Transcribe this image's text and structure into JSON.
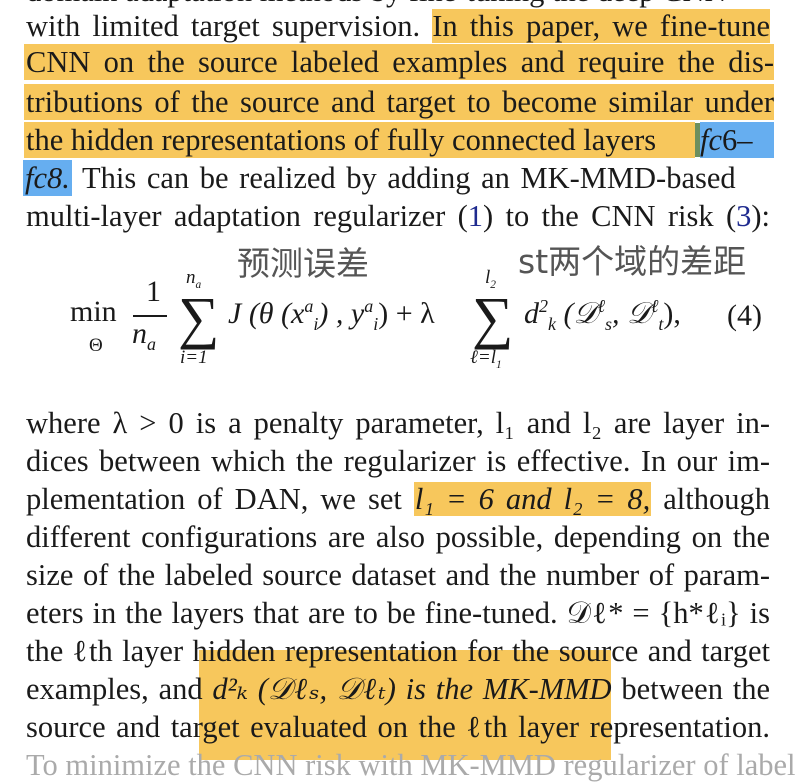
{
  "paragraph1": {
    "line1_plain": "with limited target supervision. ",
    "line1_hl": "In this paper, we fine-tune",
    "line2_hl": "CNN on the source labeled examples and require the dis-",
    "line3_hl": "tributions of the source and target to become similar under",
    "line4_hl": "the hidden representations of fully connected layers ",
    "line4_math_f": "f",
    "line4_math_c": "c",
    "line4_math_num": "6–",
    "line5_math": "fc8.",
    "line5_plain": " This can be realized by adding an MK-MMD-based",
    "line6_a": "multi-layer adaptation regularizer (",
    "line6_ref1": "1",
    "line6_b": ") to the CNN risk (",
    "line6_ref2": "3",
    "line6_c": "):"
  },
  "equation": {
    "min": "min",
    "min_sub": "Θ",
    "frac_num": "1",
    "frac_den": "n",
    "frac_den_sub": "a",
    "sum1_top": "n",
    "sum1_top_sub": "a",
    "sum1_bottom": "i=1",
    "sum_symbol": "∑",
    "term1": "J (θ (x",
    "term1_sup": "a",
    "term1_sub": "i",
    "term1_b": ") , y",
    "term1_b_sup": "a",
    "term1_b_sub": "i",
    "term1_close": ") + λ",
    "sum2_top": "l",
    "sum2_top_sub": "2",
    "sum2_bottom": "ℓ=l",
    "sum2_bottom_sub": "1",
    "term2": "d",
    "term2_sup": "2",
    "term2_sub": "k",
    "term2_args": "(𝒟",
    "term2_arg1_sup": "ℓ",
    "term2_arg1_sub": "s",
    "term2_comma": ", 𝒟",
    "term2_arg2_sup": "ℓ",
    "term2_arg2_sub": "t",
    "term2_close": "),",
    "number": "(4)",
    "note_left": "预测误差",
    "note_right": "st两个域的差距"
  },
  "paragraph2": {
    "line1": "where λ > 0 is a penalty parameter, l₁ and l₂ are layer in-",
    "line2": "dices between which the regularizer is effective. In our im-",
    "line3_a": "plementation of DAN, we set ",
    "line3_hl": "l₁ = 6 and l₂ = 8,",
    "line3_b": " although",
    "line4": "different configurations are also possible, depending on the",
    "line5": "size of the labeled source dataset and the number of param-",
    "line6": "eters in the layers that are to be fine-tuned. 𝒟ℓ* = {h*ℓᵢ} is",
    "line7": "the ℓth layer hidden representation for the source and target",
    "line8_a": "examples, and ",
    "line8_hl": "d²ₖ (𝒟ℓₛ, 𝒟ℓₜ) is the MK-MMD",
    "line8_b": " between the",
    "line9_a": "source and tar",
    "line9_hl": "get evaluated on the ℓth layer rep",
    "line9_b": "resentation.",
    "line10_faded": "To minimize the CNN risk with MK-MMD regularizer of labeled"
  },
  "colors": {
    "highlight_orange": "#f7c75c",
    "highlight_blue": "#66aef0",
    "highlight_green": "#6c8f5e",
    "ref_link": "#1f2b8f",
    "annotation_gray": "#555555"
  }
}
